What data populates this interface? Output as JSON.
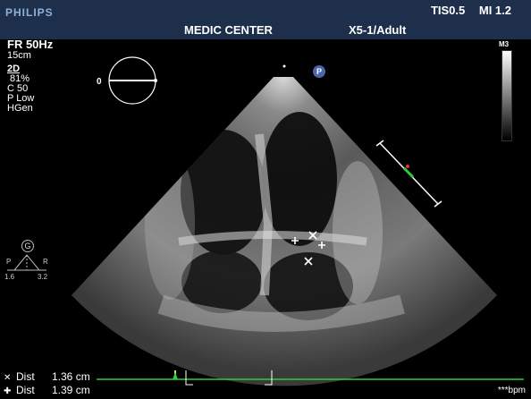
{
  "header": {
    "brand": "PHILIPS",
    "tis": "TIS0.5",
    "mi": "MI 1.2",
    "center": "MEDIC CENTER",
    "probe": "X5-1/Adult"
  },
  "params": {
    "frame_rate": "FR 50Hz",
    "depth": "15cm",
    "mode": "2D",
    "gain": "81%",
    "compression": "C 50",
    "power": "P Low",
    "harmonics": "HGen"
  },
  "grayscale_label": "M3",
  "orientation": {
    "zero_label": "0",
    "p_marker": "P"
  },
  "gauge": {
    "letter": "G",
    "left": "P",
    "right": "R",
    "left_value": "1.6",
    "right_value": "3.2"
  },
  "measurements": [
    {
      "symbol": "✕",
      "label": "Dist",
      "value": "1.36 cm"
    },
    {
      "symbol": "✚",
      "label": "Dist",
      "value": "1.39 cm"
    }
  ],
  "heart_rate": "***bpm",
  "colors": {
    "header_bg": "#1e2f4c",
    "ecg_trace": "#2ecc40",
    "p_marker": "#4a66a8"
  }
}
